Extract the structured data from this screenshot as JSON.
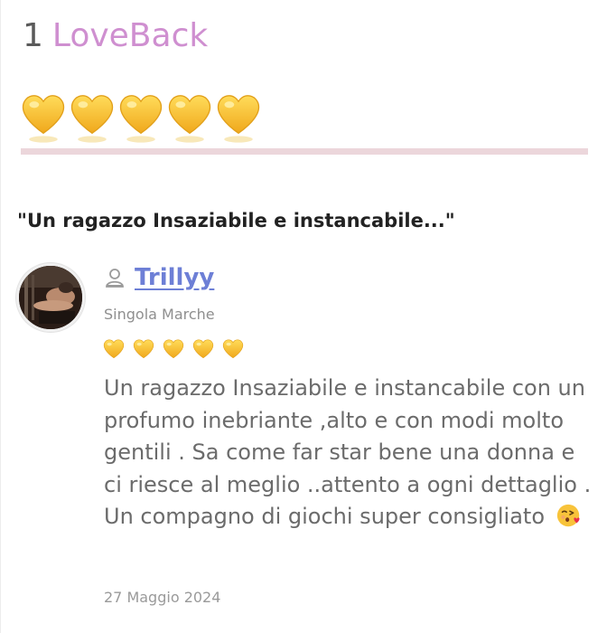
{
  "header": {
    "count": "1",
    "brand": "LoveBack"
  },
  "overall_rating": {
    "hearts": 5,
    "max": 5,
    "icon": "gold-heart-icon",
    "color": "#f6c23a"
  },
  "review": {
    "title": "\"Un ragazzo Insaziabile e instancabile...\"",
    "author": {
      "username": "Trillyy",
      "location": "Singola Marche",
      "avatar": "avatar-photo",
      "user_icon": "user-silhouette-icon"
    },
    "rating": {
      "hearts": 5,
      "max": 5
    },
    "body": "Un ragazzo Insaziabile e instancabile con un profumo inebriante ,alto e con modi molto gentili . Sa come far star bene una donna e ci riesce al meglio ..attento a ogni dettaglio . Un compagno di giochi super consigliato",
    "emoji": "face-blowing-kiss-emoji",
    "date": "27 Maggio 2024"
  },
  "colors": {
    "brand": "#cf8fd0",
    "username_link": "#6d7fd6",
    "divider": "#ecd6db",
    "heart_gold": "#f6c23a"
  }
}
